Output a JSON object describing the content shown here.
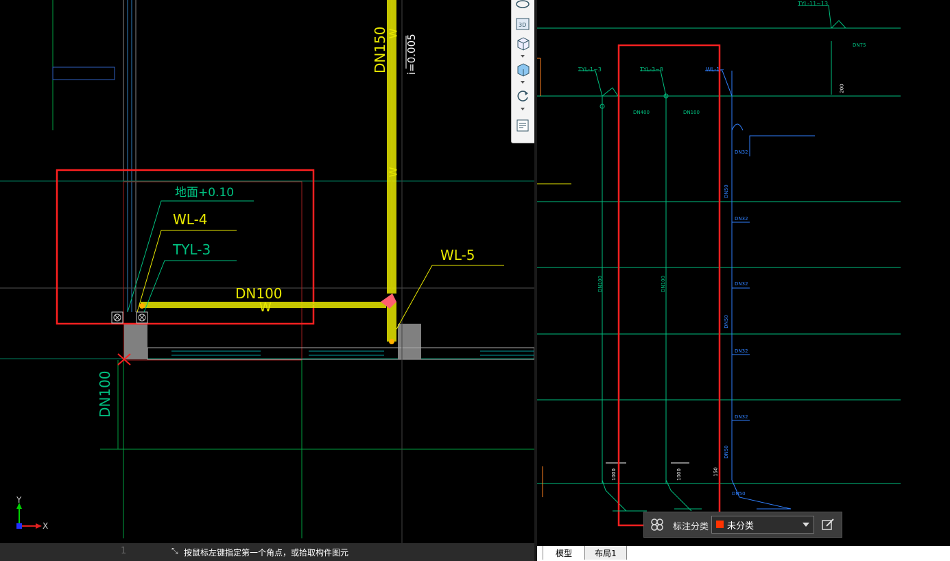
{
  "left_view": {
    "labels": {
      "floor": "地面+0.10",
      "wl4": "WL-4",
      "tyl3": "TYL-3",
      "wl5": "WL-5",
      "dn100_h": "DN100",
      "dn100_v": "DN100",
      "dn150": "DN150",
      "slope": "i=0.005",
      "w1": "W",
      "w2": "W",
      "w3": "W",
      "grid1": "1"
    },
    "axis": {
      "x": "X",
      "y": "Y"
    }
  },
  "status_bar": {
    "text": "按鼠标左键指定第一个角点，或拾取构件图元"
  },
  "right_view": {
    "labels": {
      "tyl1_3": "TYL-1~3",
      "tyl3_8": "TYL-3~8",
      "wl1": "WL-1~",
      "tyl11": "TYL-11~13",
      "dn400_1": "DN400",
      "dn100_1": "DN100",
      "dn32_1": "DN32",
      "dn50_1": "DN50",
      "dn32_2": "DN32",
      "dn32_3": "DN32",
      "dn50_2": "DN50",
      "dn32_4": "DN32",
      "dn32_5": "DN32",
      "dn50_3": "DN50",
      "dn50_4": "DN50",
      "dn75": "DN75",
      "dn100_v1": "DN100",
      "dn100_v2": "DN100",
      "dim1000a": "1000",
      "dim1000b": "1000",
      "dim200": "200",
      "dim150": "150"
    }
  },
  "tag_bar": {
    "label": "标注分类",
    "value": "未分类"
  },
  "tabs": {
    "model": "模型",
    "layout": "布局1"
  },
  "colors": {
    "pipe_yellow": "#e8e800",
    "cad_green": "#00c080",
    "cad_cyan": "#00c8c8",
    "cad_blue": "#3080ff",
    "highlight_red": "#ff2020"
  }
}
